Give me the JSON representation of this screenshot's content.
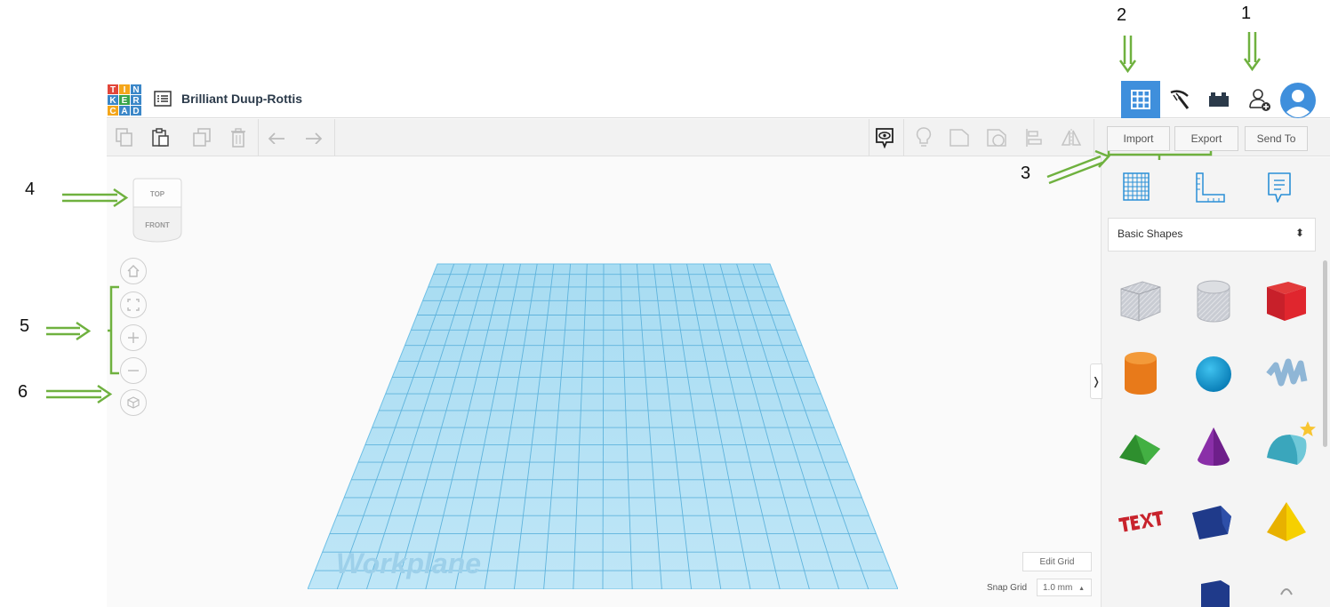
{
  "app": {
    "design_title": "Brilliant Duup-Rottis",
    "logo_letters": [
      "T",
      "I",
      "N",
      "K",
      "E",
      "R",
      "C",
      "A",
      "D"
    ]
  },
  "toolbar": {
    "import_label": "Import",
    "export_label": "Export",
    "send_to_label": "Send To"
  },
  "panel": {
    "category_selected": "Basic Shapes"
  },
  "viewcube": {
    "top_label": "TOP",
    "front_label": "FRONT"
  },
  "workplane": {
    "watermark": "Workplane"
  },
  "grid": {
    "edit_label": "Edit Grid",
    "snap_label": "Snap Grid",
    "snap_value": "1.0 mm"
  },
  "annotations": [
    "1",
    "2",
    "3",
    "4",
    "5",
    "6"
  ],
  "colors": {
    "accent": "#3f8fdc",
    "annotation": "#6fb13f",
    "workplane": "#7ec8ea"
  }
}
